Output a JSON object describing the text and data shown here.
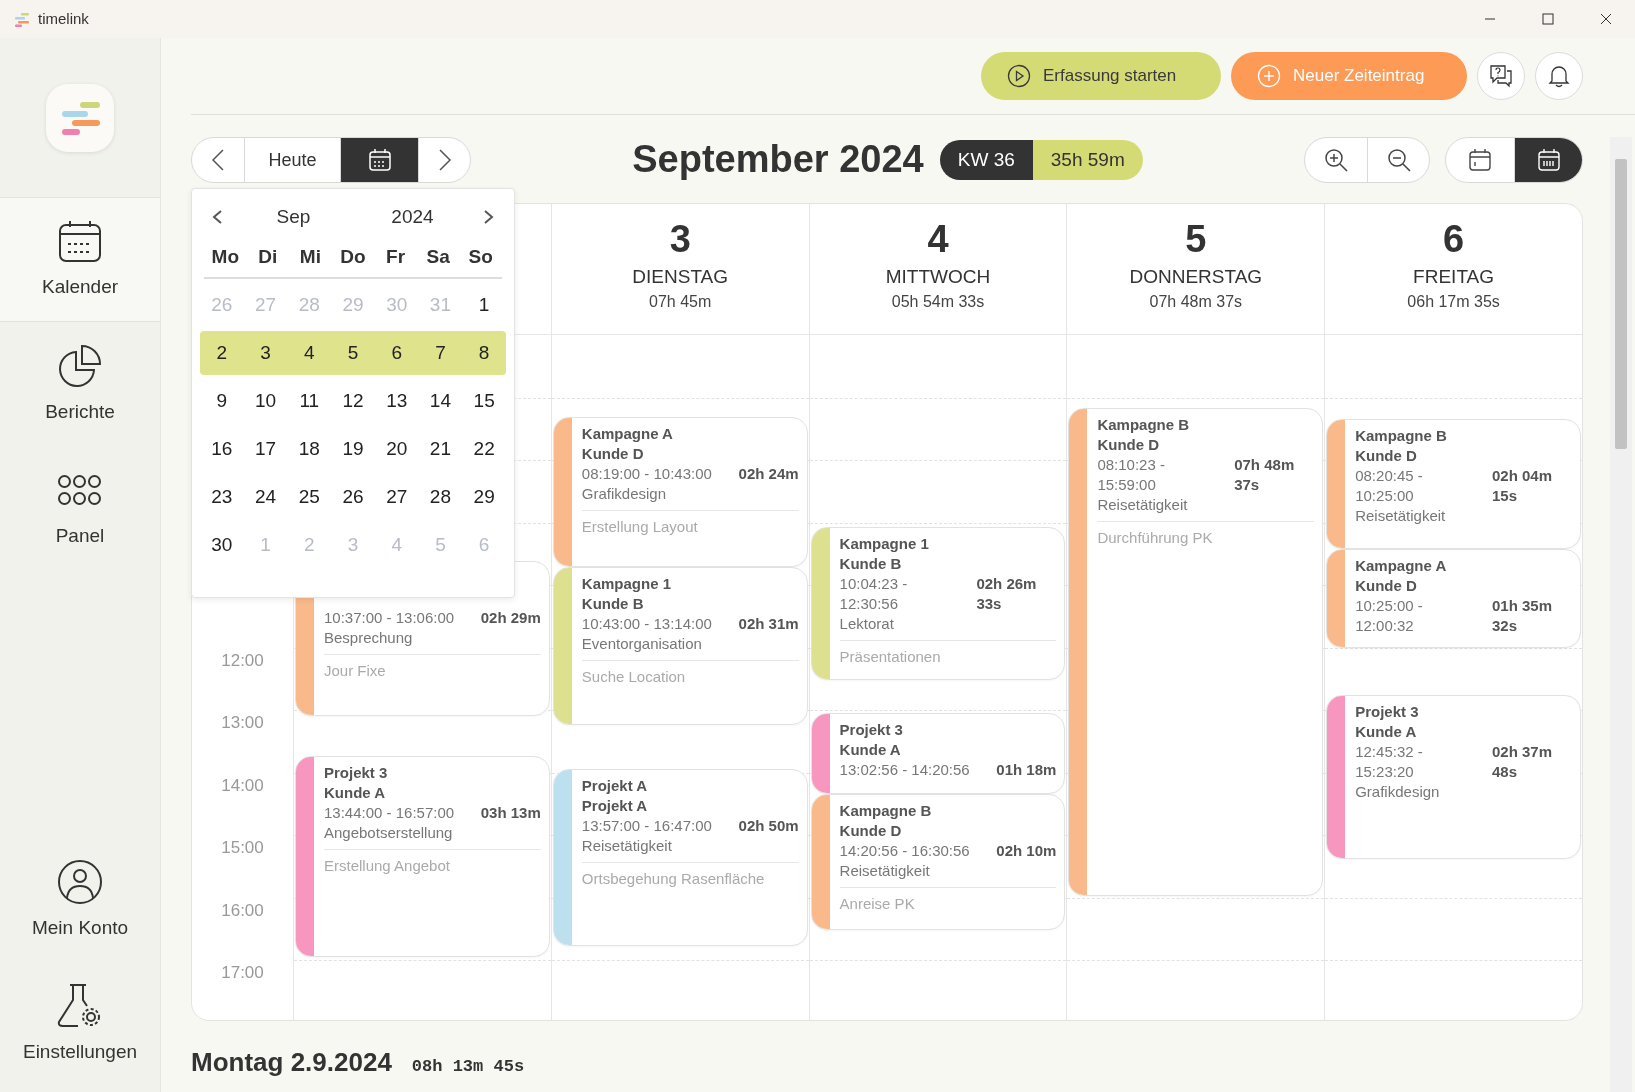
{
  "window": {
    "title": "timelink"
  },
  "sidebar": {
    "items": [
      {
        "kind": "calendar",
        "label": "Kalender",
        "selected": true
      },
      {
        "kind": "reports",
        "label": "Berichte",
        "selected": false
      },
      {
        "kind": "panel",
        "label": "Panel",
        "selected": false
      }
    ],
    "footer_items": [
      {
        "kind": "account",
        "label": "Mein Konto",
        "selected": false
      },
      {
        "kind": "settings",
        "label": "Einstellungen",
        "selected": false
      }
    ]
  },
  "toolbar": {
    "buttons": [
      {
        "kind": "start",
        "label": "Erfassung starten"
      },
      {
        "kind": "new",
        "label": "Neuer Zeiteintrag"
      }
    ]
  },
  "nav": {
    "today": "Heute",
    "picker_open": true
  },
  "heading": {
    "title": "September 2024",
    "week": "KW 36",
    "week_total": "35h 59m"
  },
  "views": [
    {
      "kind": "day",
      "selected": false
    },
    {
      "kind": "week",
      "selected": true
    }
  ],
  "datepicker": {
    "month": "Sep",
    "year": "2024",
    "weekdays": [
      "Mo",
      "Di",
      "Mi",
      "Do",
      "Fr",
      "Sa",
      "So"
    ],
    "weeks": [
      {
        "selected": false,
        "days": [
          {
            "label": "26",
            "muted": true
          },
          {
            "label": "27",
            "muted": true
          },
          {
            "label": "28",
            "muted": true
          },
          {
            "label": "29",
            "muted": true
          },
          {
            "label": "30",
            "muted": true
          },
          {
            "label": "31",
            "muted": true
          },
          {
            "label": "1",
            "muted": false
          }
        ]
      },
      {
        "selected": true,
        "days": [
          {
            "label": "2",
            "muted": false
          },
          {
            "label": "3",
            "muted": false
          },
          {
            "label": "4",
            "muted": false
          },
          {
            "label": "5",
            "muted": false
          },
          {
            "label": "6",
            "muted": false
          },
          {
            "label": "7",
            "muted": false
          },
          {
            "label": "8",
            "muted": false
          }
        ]
      },
      {
        "selected": false,
        "days": [
          {
            "label": "9",
            "muted": false
          },
          {
            "label": "10",
            "muted": false
          },
          {
            "label": "11",
            "muted": false
          },
          {
            "label": "12",
            "muted": false
          },
          {
            "label": "13",
            "muted": false
          },
          {
            "label": "14",
            "muted": false
          },
          {
            "label": "15",
            "muted": false
          }
        ]
      },
      {
        "selected": false,
        "days": [
          {
            "label": "16",
            "muted": false
          },
          {
            "label": "17",
            "muted": false
          },
          {
            "label": "18",
            "muted": false
          },
          {
            "label": "19",
            "muted": false
          },
          {
            "label": "20",
            "muted": false
          },
          {
            "label": "21",
            "muted": false
          },
          {
            "label": "22",
            "muted": false
          }
        ]
      },
      {
        "selected": false,
        "days": [
          {
            "label": "23",
            "muted": false
          },
          {
            "label": "24",
            "muted": false
          },
          {
            "label": "25",
            "muted": false
          },
          {
            "label": "26",
            "muted": false
          },
          {
            "label": "27",
            "muted": false
          },
          {
            "label": "28",
            "muted": false
          },
          {
            "label": "29",
            "muted": false
          }
        ]
      },
      {
        "selected": false,
        "days": [
          {
            "label": "30",
            "muted": false
          },
          {
            "label": "1",
            "muted": true
          },
          {
            "label": "2",
            "muted": true
          },
          {
            "label": "3",
            "muted": true
          },
          {
            "label": "4",
            "muted": true
          },
          {
            "label": "5",
            "muted": true
          },
          {
            "label": "6",
            "muted": true
          }
        ]
      }
    ]
  },
  "calendar": {
    "hours": [
      "12:00",
      "13:00",
      "14:00",
      "15:00",
      "16:00",
      "17:00"
    ],
    "days": [
      {
        "entries": [
          {
            "time": "10:37:00 - 13:06:00",
            "duration": "02h 29m",
            "category": "Besprechung",
            "description": "Jour Fixe",
            "color": "#f9b98a"
          },
          {
            "title": "Projekt 3",
            "client": "Kunde A",
            "time": "13:44:00 - 16:57:00",
            "duration": "03h 13m",
            "category": "Angebotserstellung",
            "description": "Erstellung Angebot",
            "color": "#f797bf"
          }
        ]
      },
      {
        "number": "3",
        "name": "DIENSTAG",
        "total": "07h 45m",
        "entries": [
          {
            "title": "Kampagne A",
            "client": "Kunde D",
            "time": "08:19:00 - 10:43:00",
            "duration": "02h 24m",
            "category": "Grafikdesign",
            "description": "Erstellung Layout",
            "color": "#f9b98a"
          },
          {
            "title": "Kampagne 1",
            "client": "Kunde B",
            "time": "10:43:00 - 13:14:00",
            "duration": "02h 31m",
            "category": "Eventorganisation",
            "description": "Suche Location",
            "color": "#dce08f"
          },
          {
            "title": "Projekt A",
            "client": "Projekt A",
            "time": "13:57:00 - 16:47:00",
            "duration": "02h 50m",
            "category": "Reisetätigkeit",
            "description": "Ortsbegehung Rasenfläche",
            "color": "#bde0ef"
          }
        ]
      },
      {
        "number": "4",
        "name": "MITTWOCH",
        "total": "05h 54m 33s",
        "entries": [
          {
            "title": "Kampagne 1",
            "client": "Kunde B",
            "time": "10:04:23 - 12:30:56",
            "duration": "02h 26m 33s",
            "category": "Lektorat",
            "description": "Präsentationen",
            "color": "#dce08f"
          },
          {
            "title": "Projekt 3",
            "client": "Kunde A",
            "time": "13:02:56 - 14:20:56",
            "duration": "01h 18m",
            "color": "#f797bf"
          },
          {
            "title": "Kampagne B",
            "client": "Kunde D",
            "time": "14:20:56 - 16:30:56",
            "duration": "02h 10m",
            "category": "Reisetätigkeit",
            "description": "Anreise PK",
            "color": "#f9b98a"
          }
        ]
      },
      {
        "number": "5",
        "name": "DONNERSTAG",
        "total": "07h 48m 37s",
        "entries": [
          {
            "title": "Kampagne B",
            "client": "Kunde D",
            "time": "08:10:23 - 15:59:00",
            "duration": "07h 48m 37s",
            "category": "Reisetätigkeit",
            "description": "Durchführung PK",
            "color": "#f9b98a"
          }
        ]
      },
      {
        "number": "6",
        "name": "FREITAG",
        "total": "06h 17m 35s",
        "entries": [
          {
            "title": "Kampagne B",
            "client": "Kunde D",
            "time": "08:20:45 - 10:25:00",
            "duration": "02h 04m 15s",
            "category": "Reisetätigkeit",
            "color": "#f9b98a"
          },
          {
            "title": "Kampagne A",
            "client": "Kunde D",
            "time": "10:25:00 - 12:00:32",
            "duration": "01h 35m 32s",
            "color": "#f9b98a"
          },
          {
            "title": "Projekt 3",
            "client": "Kunde A",
            "time": "12:45:32 - 15:23:20",
            "duration": "02h 37m 48s",
            "category": "Grafikdesign",
            "color": "#f797bf"
          }
        ]
      }
    ]
  },
  "day_summary": {
    "title": "Montag 2.9.2024",
    "total": "08h 13m 45s"
  }
}
